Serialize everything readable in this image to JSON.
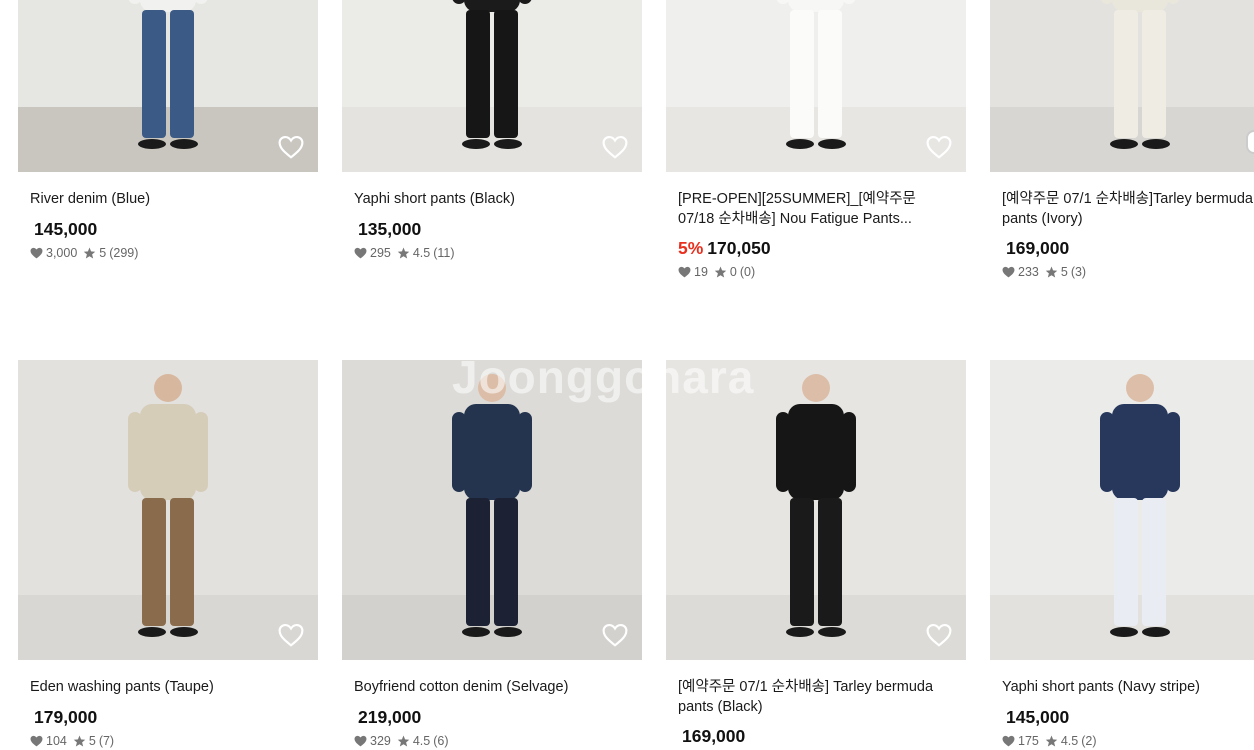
{
  "products": [
    {
      "title": "River denim (Blue)",
      "discount": "",
      "price": "145,000",
      "likes": "3,000",
      "rating": "5",
      "reviews": "(299)",
      "bg": "#e6e6e2",
      "floor": "#c9c6c0",
      "top": "#f1f1ef",
      "bottom": "#3c5a86",
      "skin": "#d9b9a2",
      "photo_icon": "model-jeans-photo"
    },
    {
      "title": "Yaphi short pants (Black)",
      "discount": "",
      "price": "135,000",
      "likes": "295",
      "rating": "4.5",
      "reviews": "(11)",
      "bg": "#ebebe8",
      "floor": "#e4e3df",
      "top": "#1b1b1b",
      "bottom": "#161616",
      "skin": "#e0c3ad",
      "photo_icon": "model-shorts-photo"
    },
    {
      "title": "[PRE-OPEN][25SUMMER]_[예약주문 07/18 순차배송] Nou Fatigue Pants...",
      "discount": "5%",
      "price": "170,050",
      "likes": "19",
      "rating": "0",
      "reviews": "(0)",
      "bg": "#efefed",
      "floor": "#e7e6e3",
      "top": "#f7f7f5",
      "bottom": "#fbfbf9",
      "skin": "#e2c4ae",
      "photo_icon": "model-white-pants-photo"
    },
    {
      "title": "[예약주문 07/1 순차배송]Tarley bermuda pants (Ivory)",
      "discount": "",
      "price": "169,000",
      "likes": "233",
      "rating": "5",
      "reviews": "(3)",
      "bg": "#e3e2df",
      "floor": "#d8d6d2",
      "top": "#e9e6dc",
      "bottom": "#efece3",
      "skin": "#dcbfa9",
      "photo_icon": "model-bermuda-photo"
    },
    {
      "title": "Eden washing pants (Taupe)",
      "discount": "",
      "price": "179,000",
      "likes": "104",
      "rating": "5",
      "reviews": "(7)",
      "bg": "#e2e1de",
      "floor": "#d9d7d3",
      "top": "#d6cdb9",
      "bottom": "#8a6c4c",
      "skin": "#d8b79f",
      "photo_icon": "model-taupe-pants-photo"
    },
    {
      "title": "Boyfriend cotton denim (Selvage)",
      "discount": "",
      "price": "219,000",
      "likes": "329",
      "rating": "4.5",
      "reviews": "(6)",
      "bg": "#dcdbd8",
      "floor": "#d2d1ce",
      "top": "#24344e",
      "bottom": "#1c2233",
      "skin": "#dcbea8",
      "photo_icon": "model-selvage-denim-photo"
    },
    {
      "title": "[예약주문 07/1 순차배송] Tarley bermuda pants (Black)",
      "discount": "",
      "price": "169,000",
      "likes": "",
      "rating": "",
      "reviews": "",
      "bg": "#e6e5e2",
      "floor": "#dcdbd7",
      "top": "#161616",
      "bottom": "#1a1a1a",
      "skin": "#dcbda7",
      "photo_icon": "model-black-bermuda-photo"
    },
    {
      "title": "Yaphi short pants (Navy stripe)",
      "discount": "",
      "price": "145,000",
      "likes": "175",
      "rating": "4.5",
      "reviews": "(2)",
      "bg": "#ebebe9",
      "floor": "#e2e1de",
      "top": "#27385c",
      "bottom": "#e9ecf2",
      "skin": "#ddbfa9",
      "photo_icon": "model-navy-stripe-photo"
    }
  ],
  "watermark": "Joonggonara"
}
